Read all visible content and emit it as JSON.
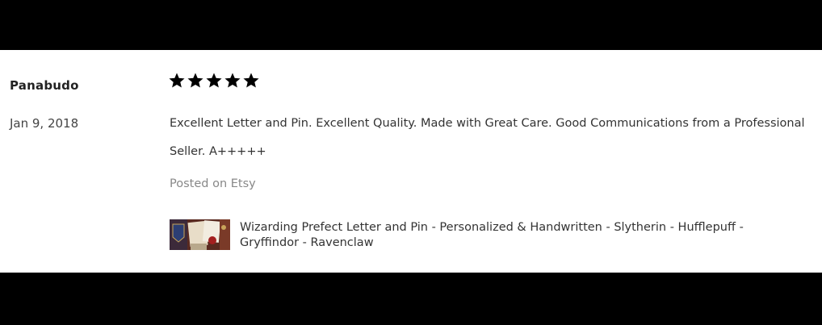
{
  "review": {
    "reviewer_name": "Panabudo",
    "date": "Jan 9, 2018",
    "rating": 5,
    "rating_max": 5,
    "text": "Excellent Letter and Pin. Excellent Quality. Made with Great Care. Good Communications from a Professional Seller. A+++++",
    "source": "Posted on Etsy",
    "listing": {
      "thumbnail_icon": "product-thumbnail",
      "title": "Wizarding Prefect Letter and Pin - Personalized & Handwritten - Slytherin - Hufflepuff - Gryffindor - Ravenclaw"
    }
  },
  "colors": {
    "star": "#000000",
    "card_background": "#ffffff",
    "letterbox": "#000000"
  }
}
